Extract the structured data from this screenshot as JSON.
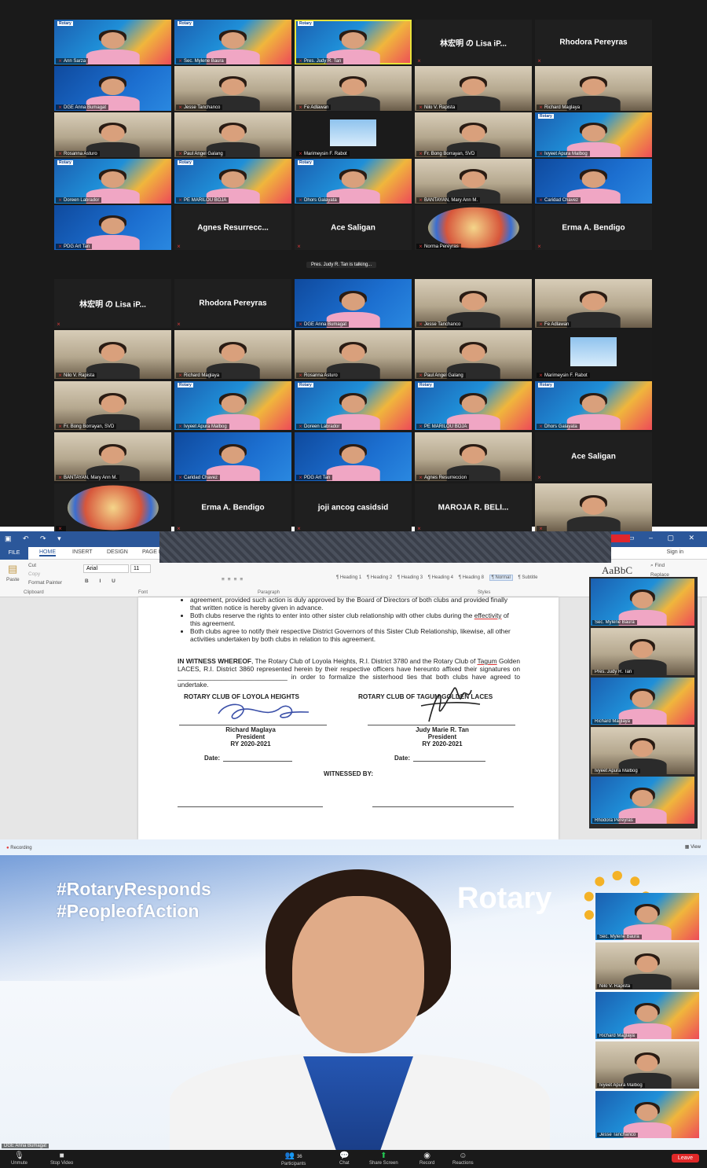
{
  "grid1": {
    "talking": "Pres. Judy R. Tan is talking...",
    "tiles": [
      {
        "label": "Ann Sarza"
      },
      {
        "label": "Sec. Mylene Baura"
      },
      {
        "label": "Pres. Judy R. Tan"
      },
      {
        "name": "林宏明 の Lisa iP..."
      },
      {
        "name": "Rhodora Pereyras"
      },
      {
        "label": "DGE Anna Bumagat"
      },
      {
        "label": "Jesse Tanchanco"
      },
      {
        "label": "Fe Adlawan"
      },
      {
        "label": "Nilo V. Rapista"
      },
      {
        "label": "Richard Maglaya"
      },
      {
        "label": "Rosanna Asturo"
      },
      {
        "label": "Paul Angel Galang"
      },
      {
        "label": "Marimeysin F. Rabot"
      },
      {
        "label": "Fr. Bong Borrayan, SVD"
      },
      {
        "label": "Ivyeet Apura Malbog"
      },
      {
        "label": "Doreen Labrador"
      },
      {
        "label": "PE MARILOU BOJA"
      },
      {
        "label": "Dhors Galayata"
      },
      {
        "label": "BANTAYAN, Mary Ann M."
      },
      {
        "label": "Caridad Chavez"
      },
      {
        "label": "PDG Art Tan"
      },
      {
        "name": "Agnes Resurrecc..."
      },
      {
        "name": "Ace Saligan"
      },
      {
        "label": "Norma Pereyras"
      },
      {
        "name": "Erma A. Bendigo"
      }
    ]
  },
  "grid2": {
    "tiles": [
      {
        "name": "林宏明 の Lisa iP..."
      },
      {
        "name": "Rhodora Pereyras"
      },
      {
        "label": "DGE Anna Bumagat"
      },
      {
        "label": "Jesse Tanchanco"
      },
      {
        "label": "Fe Adlawan"
      },
      {
        "label": "Nilo V. Rapista"
      },
      {
        "label": "Richard Maglaya"
      },
      {
        "label": "Rosanna Asturo"
      },
      {
        "label": "Paul Angel Galang"
      },
      {
        "label": "Marimeysin F. Rabot"
      },
      {
        "label": "Fr. Bong Borrayan, SVD"
      },
      {
        "label": "Ivyeet Apura Malbog"
      },
      {
        "label": "Doreen Labrador"
      },
      {
        "label": "PE MARILOU BOJA"
      },
      {
        "label": "Dhors Galayata"
      },
      {
        "label": "BANTAYAN, Mary Ann M."
      },
      {
        "label": "Caridad Chavez"
      },
      {
        "label": "PDG Art Tan"
      },
      {
        "label": "Agnes Resurreccion"
      },
      {
        "name": "Ace Saligan"
      },
      {
        "label": ""
      },
      {
        "name": "Erma A. Bendigo"
      },
      {
        "name": "joji ancog casidsid"
      },
      {
        "name": "MAROJA R. BELI..."
      },
      {
        "label": ""
      }
    ]
  },
  "word": {
    "tabs": [
      "FILE",
      "HOME",
      "INSERT",
      "DESIGN",
      "PAGE L"
    ],
    "sign_in": "Sign in",
    "font_name": "Arial",
    "font_size": "11",
    "clipboard": {
      "paste": "Paste",
      "cut": "Cut",
      "copy": "Copy",
      "format_painter": "Format Painter",
      "group": "Clipboard"
    },
    "groups": {
      "font": "Font",
      "paragraph": "Paragraph",
      "styles": "Styles"
    },
    "styles": [
      "¶ Heading 1",
      "¶ Heading 2",
      "¶ Heading 3",
      "¶ Heading 4",
      "¶ Heading 8",
      "¶ Normal",
      "¶ Subtitle"
    ],
    "style_preview": "AaBbC",
    "find": "Find",
    "replace": "Replace",
    "doc": {
      "bullet1": "agreement, provided such action is duly approved by the Board of Directors of both clubs and provided finally that written notice is hereby given in advance.",
      "bullet2": "Both clubs reserve the rights to enter into other sister club relationship with other clubs during the",
      "bullet2_u": "effectivity",
      "bullet2_tail": "of this agreement.",
      "bullet3": "Both clubs agree to notify their respective District Governors of this Sister Club Relationship, likewise, all other activities undertaken by both clubs in relation to this agreement.",
      "witness_lead": "IN WITNESS WHEREOF",
      "witness_a": ", The Rotary Club of Loyola Heights, R.I. District 3780 and the Rotary Club of",
      "witness_u": "Tagum",
      "witness_b": "Golden LACES, R.I. District 3860 represented herein by their respective officers have hereunto affixed their signatures on ______________________________ in order to formalize the sisterhood ties that both clubs have agreed to undertake.",
      "club_left": "ROTARY CLUB OF LOYOLA HEIGHTS",
      "club_right": "ROTARY CLUB OF TAGUM GOLDEN LACES",
      "sig_left_name": "Richard Maglaya",
      "sig_left_title": "President",
      "sig_left_ry": "RY 2020-2021",
      "sig_right_name": "Judy Marie R. Tan",
      "sig_right_title": "President",
      "sig_right_ry": "RY 2020-2021",
      "date_label": "Date:",
      "witnessed": "WITNESSED BY:"
    },
    "side": [
      {
        "label": "Sec. Mylene Baura"
      },
      {
        "label": "Pres. Judy R. Tan"
      },
      {
        "label": "Richard Maglaya"
      },
      {
        "label": "Ivyeet Apura Malbog"
      },
      {
        "label": "Rhodora Pereyras"
      }
    ]
  },
  "speaker": {
    "recording": "Recording",
    "view": "View",
    "hashtag1": "#RotaryResponds",
    "hashtag2": "#PeopleofAction",
    "rotary": "Rotary",
    "name": "DGE Anna Bumagat",
    "strip": [
      {
        "label": "Sec. Mylene Baura"
      },
      {
        "label": "Nilo V. Rapista"
      },
      {
        "label": "Richard Maglaya"
      },
      {
        "label": "Ivyeet Apura Malbog"
      },
      {
        "label": "Jesse Tanchanco"
      }
    ]
  },
  "toolbar": {
    "unmute": "Unmute",
    "stop_video": "Stop Video",
    "participants": "Participants",
    "participants_count": "36",
    "chat": "Chat",
    "share_screen": "Share Screen",
    "record": "Record",
    "reactions": "Reactions",
    "leave": "Leave"
  },
  "colors": {
    "accent": "#2b579a",
    "leave": "#e02828",
    "speaking": "#e8e23a",
    "share": "#23c552"
  },
  "icons": [
    "mic-muted-icon",
    "video-icon",
    "participants-icon",
    "chat-icon",
    "share-screen-icon",
    "record-icon",
    "reactions-icon",
    "rotary-gear-icon",
    "recording-dot-icon",
    "find-icon",
    "paste-icon"
  ]
}
